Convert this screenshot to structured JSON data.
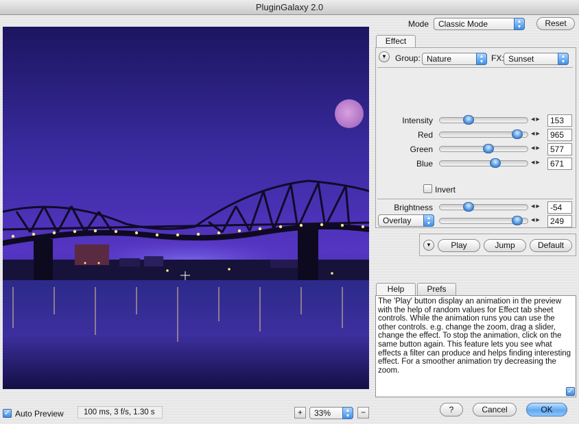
{
  "window": {
    "title": "PluginGalaxy 2.0"
  },
  "mode": {
    "label": "Mode",
    "value": "Classic Mode",
    "reset_label": "Reset"
  },
  "effect_tab": {
    "tab_label": "Effect",
    "group_label": "Group:",
    "group_value": "Nature",
    "fx_label": "FX:",
    "fx_value": "Sunset",
    "sliders": [
      {
        "label": "Intensity",
        "value": "153",
        "fraction": 0.3
      },
      {
        "label": "Red",
        "value": "965",
        "fraction": 0.94
      },
      {
        "label": "Green",
        "value": "577",
        "fraction": 0.56
      },
      {
        "label": "Blue",
        "value": "671",
        "fraction": 0.65
      }
    ],
    "invert_label": "Invert",
    "invert_checked": false,
    "brightness": {
      "label": "Brightness",
      "value": "-54",
      "fraction": 0.3
    },
    "blend": {
      "mode": "Overlay",
      "value": "249",
      "fraction": 0.94
    }
  },
  "animation": {
    "play_label": "Play",
    "jump_label": "Jump",
    "default_label": "Default"
  },
  "help": {
    "tab_help": "Help",
    "tab_prefs": "Prefs",
    "text": "The 'Play' button display an animation in the preview with the help of random values for Effect tab sheet controls. While the animation runs you can use the other controls. e.g. change the zoom, drag a slider, change the effect. To stop the animation, click on the same button again. This feature lets you see what effects a filter can produce and helps finding interesting effect. For a smoother animation try decreasing the zoom."
  },
  "footer": {
    "auto_preview_label": "Auto Preview",
    "auto_preview_checked": true,
    "status": "100 ms, 3 f/s, 1.30 s",
    "zoom_value": "33%",
    "zoom_in": "+",
    "zoom_out": "−",
    "help_label": "?",
    "cancel_label": "Cancel",
    "ok_label": "OK"
  },
  "icons": {
    "disclosure": "disclosure-triangle-icon",
    "check": "checkmark-icon",
    "crosshair": "crosshair-cursor-icon"
  }
}
